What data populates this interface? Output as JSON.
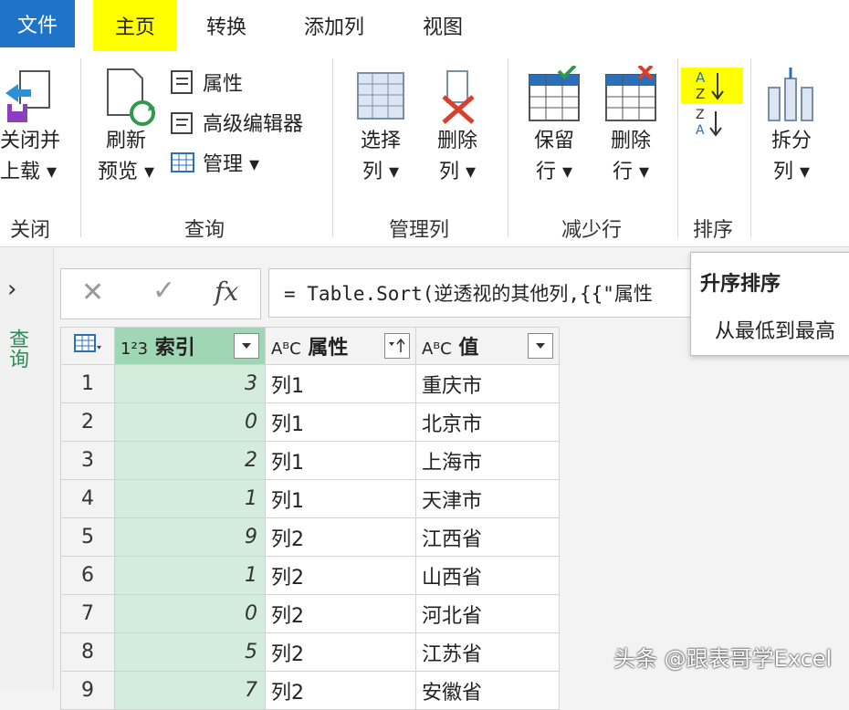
{
  "tabs": {
    "file": "文件",
    "items": [
      "主页",
      "转换",
      "添加列",
      "视图"
    ]
  },
  "ribbon": {
    "close": {
      "line1": "关闭并",
      "line2": "上载 ▾",
      "group": "关闭"
    },
    "refresh": {
      "line1": "刷新",
      "line2": "预览 ▾"
    },
    "query_items": [
      "属性",
      "高级编辑器",
      "管理 ▾"
    ],
    "query_group": "查询",
    "select_cols": {
      "line1": "选择",
      "line2": "列 ▾"
    },
    "remove_cols": {
      "line1": "删除",
      "line2": "列 ▾"
    },
    "manage_group": "管理列",
    "keep_rows": {
      "line1": "保留",
      "line2": "行 ▾"
    },
    "remove_rows": {
      "line1": "删除",
      "line2": "行 ▾"
    },
    "reduce_group": "减少行",
    "sort_group": "排序",
    "split": {
      "line1": "拆分",
      "line2": "列 ▾"
    }
  },
  "nav": {
    "label": "查询"
  },
  "formula": {
    "cancel": "✕",
    "confirm": "✓",
    "fx": "fx",
    "expression": "= Table.Sort(逆透视的其他列,{{\"属性"
  },
  "tooltip": {
    "title": "升序排序",
    "body": "从最低到最高"
  },
  "table": {
    "headers": [
      {
        "type": "1²3",
        "name": "索引"
      },
      {
        "type": "AᴮC",
        "name": "属性"
      },
      {
        "type": "AᴮC",
        "name": "值"
      }
    ],
    "rows": [
      {
        "n": "1",
        "idx": "3",
        "attr": "列1",
        "val": "重庆市"
      },
      {
        "n": "2",
        "idx": "0",
        "attr": "列1",
        "val": "北京市"
      },
      {
        "n": "3",
        "idx": "2",
        "attr": "列1",
        "val": "上海市"
      },
      {
        "n": "4",
        "idx": "1",
        "attr": "列1",
        "val": "天津市"
      },
      {
        "n": "5",
        "idx": "9",
        "attr": "列2",
        "val": "江西省"
      },
      {
        "n": "6",
        "idx": "1",
        "attr": "列2",
        "val": "山西省"
      },
      {
        "n": "7",
        "idx": "0",
        "attr": "列2",
        "val": "河北省"
      },
      {
        "n": "8",
        "idx": "5",
        "attr": "列2",
        "val": "江苏省"
      },
      {
        "n": "9",
        "idx": "7",
        "attr": "列2",
        "val": "安徽省"
      }
    ]
  },
  "watermark": "头条 @跟表哥学Excel"
}
